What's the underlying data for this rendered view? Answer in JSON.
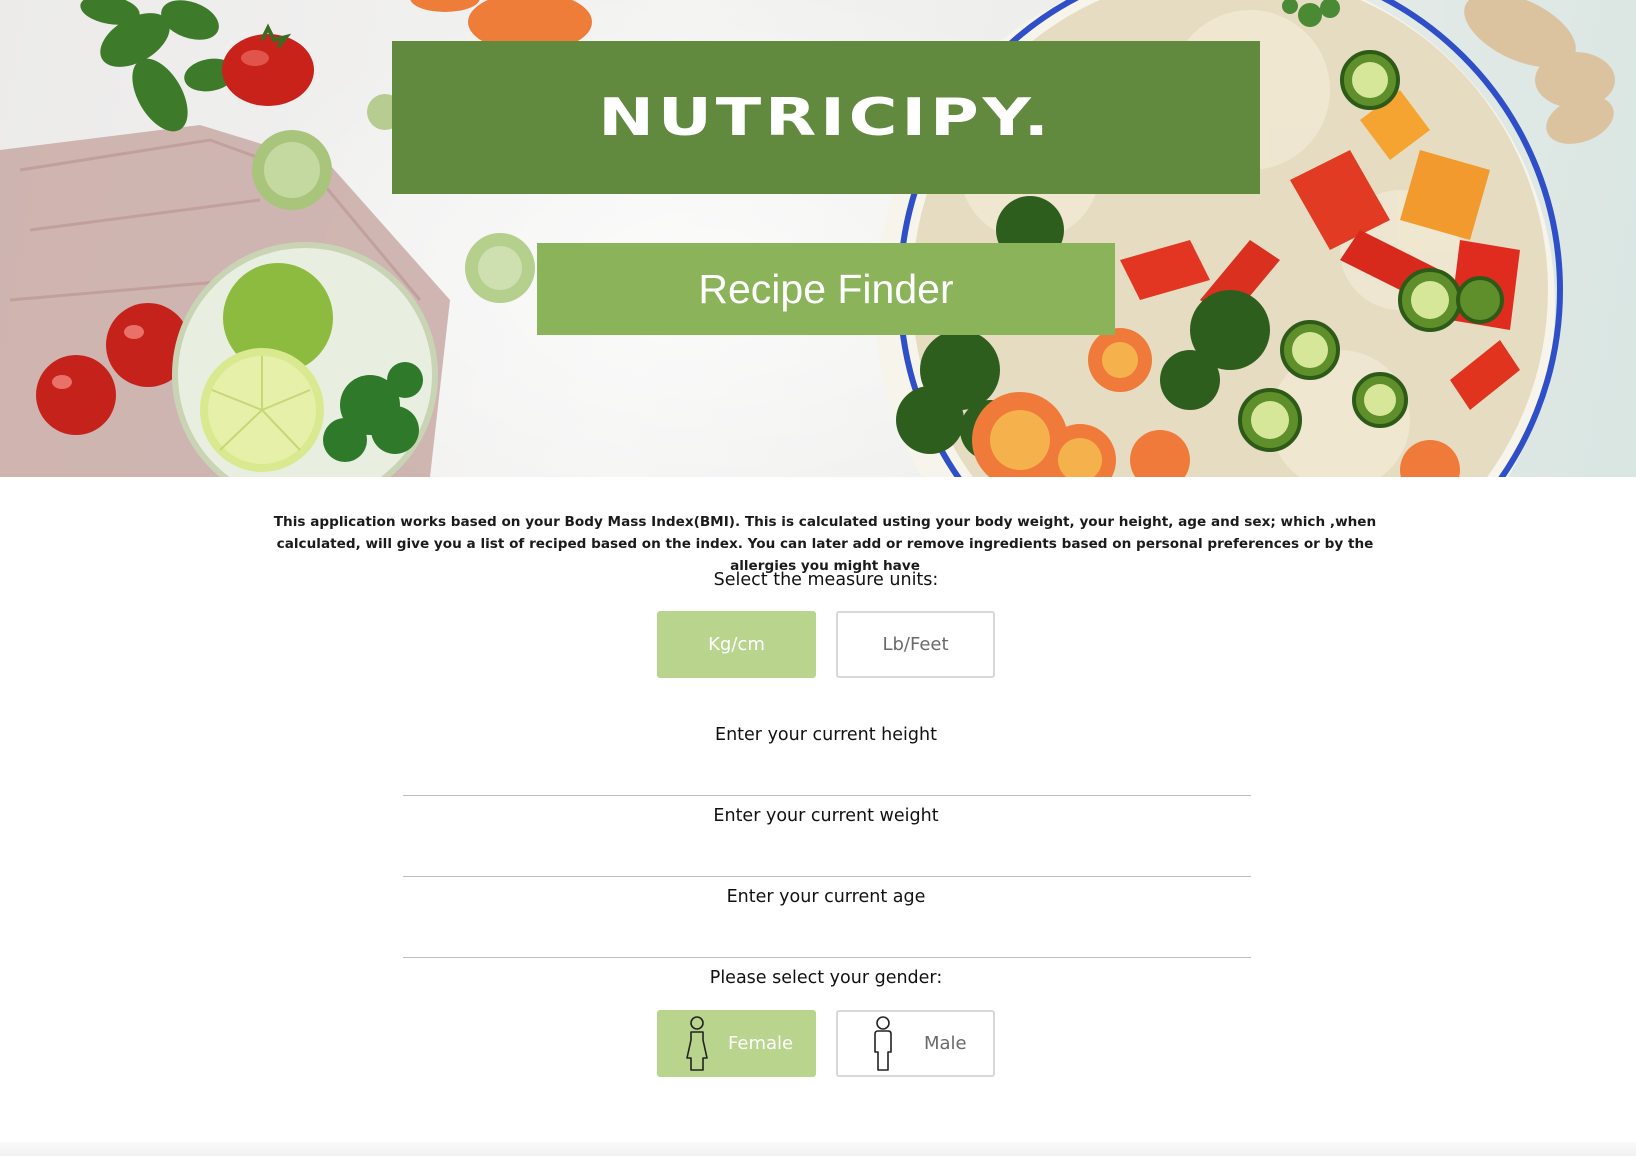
{
  "brand": {
    "name": "NUTRICIPY."
  },
  "hero": {
    "title": "Recipe Finder"
  },
  "intro": {
    "text": "This application works based on your Body Mass Index(BMI). This is calculated usting your body weight, your height, age and sex; which ,when calculated, will give you a list of reciped based on the index. You can later add or remove ingredients based on personal preferences or by the allergies you might have"
  },
  "units": {
    "label": "Select the measure units:",
    "options": [
      "Kg/cm",
      "Lb/Feet"
    ],
    "selected": "Kg/cm"
  },
  "fields": {
    "height_label": "Enter your current height",
    "height_value": "",
    "weight_label": "Enter your current weight",
    "weight_value": "",
    "age_label": "Enter your current age",
    "age_value": ""
  },
  "gender": {
    "label": "Please select your gender:",
    "options": [
      "Female",
      "Male"
    ],
    "selected": "Female",
    "icons": [
      "female-person-icon",
      "male-person-icon"
    ]
  },
  "colors": {
    "brand_green": "#628a3f",
    "title_green": "#8ab35a",
    "active_button": "#b8d48d",
    "inactive_border": "#d8d8d8"
  }
}
